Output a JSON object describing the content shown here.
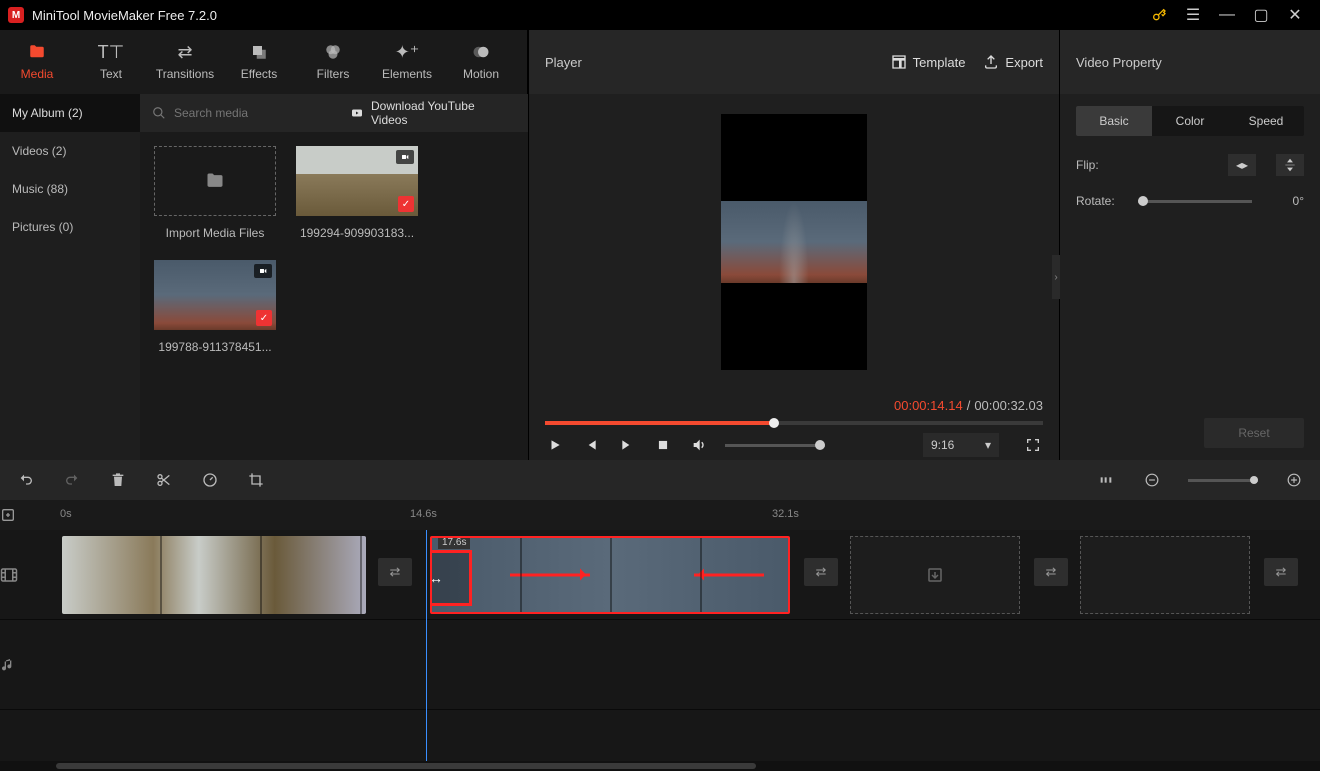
{
  "app": {
    "title": "MiniTool MovieMaker Free 7.2.0"
  },
  "topTabs": [
    {
      "label": "Media"
    },
    {
      "label": "Text"
    },
    {
      "label": "Transitions"
    },
    {
      "label": "Effects"
    },
    {
      "label": "Filters"
    },
    {
      "label": "Elements"
    },
    {
      "label": "Motion"
    }
  ],
  "player": {
    "title": "Player",
    "templateLabel": "Template",
    "exportLabel": "Export",
    "currentTime": "00:00:14.14",
    "totalTime": "00:00:32.03",
    "ratio": "9:16"
  },
  "property": {
    "title": "Video Property",
    "tabs": {
      "basic": "Basic",
      "color": "Color",
      "speed": "Speed"
    },
    "flipLabel": "Flip:",
    "rotateLabel": "Rotate:",
    "rotateValue": "0°",
    "resetLabel": "Reset"
  },
  "media": {
    "albumLabel": "My Album (2)",
    "searchPlaceholder": "Search media",
    "ytLabel": "Download YouTube Videos",
    "sidebar": {
      "videos": "Videos (2)",
      "music": "Music (88)",
      "pictures": "Pictures (0)"
    },
    "items": {
      "import": "Import Media Files",
      "item1": "199294-909903183...",
      "item2": "199788-911378451..."
    }
  },
  "timeline": {
    "tick0": "0s",
    "tick1": "14.6s",
    "tick2": "32.1s",
    "clip2Time": "17.6s"
  }
}
